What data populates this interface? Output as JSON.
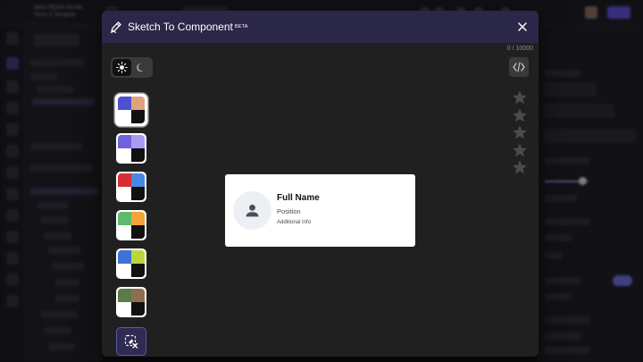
{
  "background_app": {
    "title": "demo REDIA Scrolls",
    "subtitle": "Victor Z Template"
  },
  "modal": {
    "title": "Sketch To Component",
    "badge": "BETA",
    "counter": "0 / 10000",
    "theme": {
      "selected": "light"
    },
    "palettes": [
      {
        "name": "blue-orange",
        "colors": [
          "#4f4fcf",
          "#e2a27e",
          "#ffffff",
          "#101010"
        ],
        "selected": true
      },
      {
        "name": "violet",
        "colors": [
          "#6e63d8",
          "#a79bf2",
          "#ffffff",
          "#101010"
        ],
        "selected": false
      },
      {
        "name": "red-blue",
        "colors": [
          "#d62e35",
          "#4a86e3",
          "#ffffff",
          "#101010"
        ],
        "selected": false
      },
      {
        "name": "green-orange",
        "colors": [
          "#5fba6c",
          "#f2a33a",
          "#ffffff",
          "#101010"
        ],
        "selected": false
      },
      {
        "name": "blue-lime",
        "colors": [
          "#3d72d6",
          "#bcd63e",
          "#ffffff",
          "#101010"
        ],
        "selected": false
      },
      {
        "name": "olive-brown",
        "colors": [
          "#5c7a4a",
          "#8d6f50",
          "#ffffff",
          "#101010"
        ],
        "selected": false
      }
    ],
    "rating": {
      "max": 5,
      "value": 0
    }
  },
  "preview_card": {
    "name": "Full Name",
    "position": "Position",
    "additional": "Additional Info"
  },
  "colors": {
    "header_bg": "#2a2748",
    "modal_bg": "#202020",
    "accent": "#5d58a8"
  }
}
